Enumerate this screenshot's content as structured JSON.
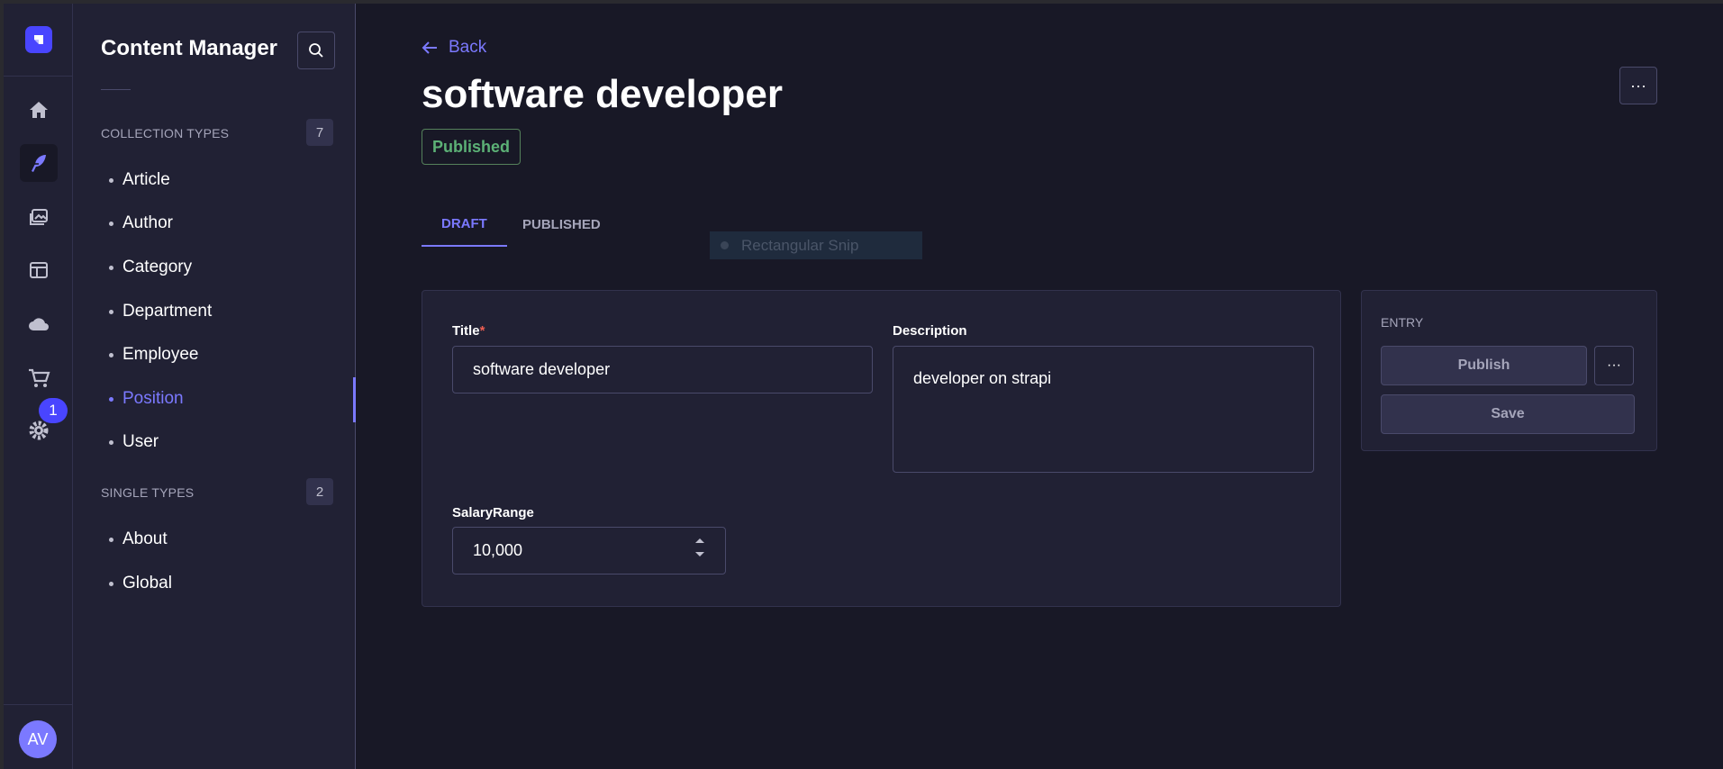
{
  "sidebar_rail": {
    "notification_count": "1",
    "avatar_initials": "AV"
  },
  "subnav": {
    "title": "Content Manager",
    "collection_types": {
      "heading": "COLLECTION TYPES",
      "count": "7",
      "items": [
        {
          "label": "Article"
        },
        {
          "label": "Author"
        },
        {
          "label": "Category"
        },
        {
          "label": "Department"
        },
        {
          "label": "Employee"
        },
        {
          "label": "Position"
        },
        {
          "label": "User"
        }
      ],
      "active_item": "Position"
    },
    "single_types": {
      "heading": "SINGLE TYPES",
      "count": "2",
      "items": [
        {
          "label": "About"
        },
        {
          "label": "Global"
        }
      ]
    }
  },
  "header": {
    "back_label": "Back",
    "title": "software developer",
    "status": "Published"
  },
  "tabs": [
    {
      "label": "DRAFT",
      "active": true
    },
    {
      "label": "PUBLISHED",
      "active": false
    }
  ],
  "overlay": {
    "snip_label": "Rectangular Snip"
  },
  "form": {
    "title_label": "Title",
    "title_required_mark": "*",
    "title_value": "software developer",
    "description_label": "Description",
    "description_value": "developer on strapi",
    "salary_label": "SalaryRange",
    "salary_value": "10,000"
  },
  "entry_panel": {
    "heading": "ENTRY",
    "publish_label": "Publish",
    "save_label": "Save"
  },
  "colors": {
    "accent": "#7b79ff",
    "brand": "#4945ff",
    "published_green": "#5cb176",
    "required_red": "#ee5e52",
    "background": "#181826",
    "panel": "#212134"
  }
}
